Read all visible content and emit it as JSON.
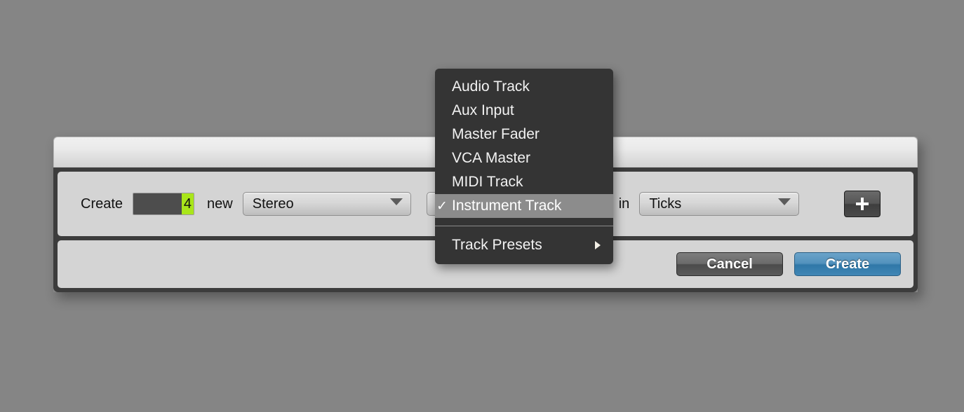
{
  "window": {
    "title": ""
  },
  "form": {
    "create_label": "Create",
    "count_value": "4",
    "new_label": "new",
    "format_value": "Stereo",
    "type_value": "Instrument Track",
    "in_label": "in",
    "timebase_value": "Ticks",
    "add_row_button": "add-row"
  },
  "footer": {
    "cancel_label": "Cancel",
    "create_label": "Create"
  },
  "menu": {
    "items": [
      {
        "label": "Audio Track",
        "checked": false,
        "selected": false,
        "submenu": false
      },
      {
        "label": "Aux Input",
        "checked": false,
        "selected": false,
        "submenu": false
      },
      {
        "label": "Master Fader",
        "checked": false,
        "selected": false,
        "submenu": false
      },
      {
        "label": "VCA Master",
        "checked": false,
        "selected": false,
        "submenu": false
      },
      {
        "label": "MIDI Track",
        "checked": false,
        "selected": false,
        "submenu": false
      },
      {
        "label": "Instrument Track",
        "checked": true,
        "selected": true,
        "submenu": false
      },
      {
        "label": "Track Presets",
        "checked": false,
        "selected": false,
        "submenu": true
      }
    ],
    "checkmark": "✓"
  },
  "colors": {
    "desktop": "#858585",
    "dialog_frame": "#3c3c3c",
    "panel": "#d4d4d4",
    "menu_bg": "#343434",
    "menu_highlight": "#8c8c8c",
    "value_highlight": "#a9e61a",
    "create_button": "#3f86b5"
  }
}
